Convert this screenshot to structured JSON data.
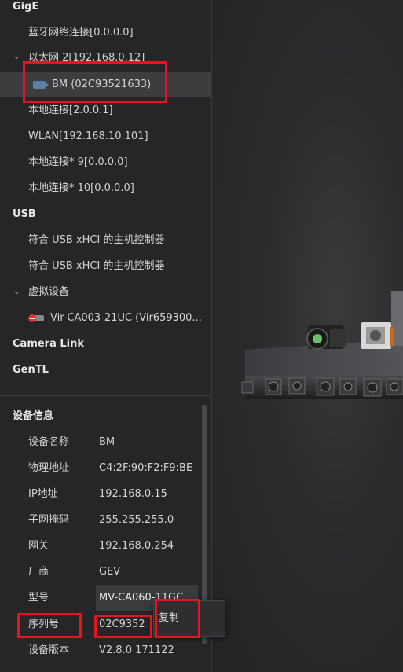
{
  "tree": {
    "gige": {
      "label": "GigE"
    },
    "items": [
      {
        "label": "蓝牙网络连接[0.0.0.0]"
      },
      {
        "label": "以太网 2[192.168.0.12]"
      },
      {
        "label": "BM (02C93521633)"
      },
      {
        "label": "本地连接[2.0.0.1]"
      },
      {
        "label": "WLAN[192.168.10.101]"
      },
      {
        "label": "本地连接* 9[0.0.0.0]"
      },
      {
        "label": "本地连接* 10[0.0.0.0]"
      }
    ],
    "usb": {
      "label": "USB"
    },
    "usb_items": [
      {
        "label": "符合 USB xHCI 的主机控制器"
      },
      {
        "label": "符合 USB xHCI 的主机控制器"
      },
      {
        "label": "虚拟设备"
      },
      {
        "label": "Vir-CA003-21UC (Vir659300..."
      }
    ],
    "camera_link": {
      "label": "Camera Link"
    },
    "gentl": {
      "label": "GenTL"
    }
  },
  "device_info": {
    "title": "设备信息",
    "props": [
      {
        "label": "设备名称",
        "value": "BM"
      },
      {
        "label": "物理地址",
        "value": "C4:2F:90:F2:F9:BE"
      },
      {
        "label": "IP地址",
        "value": "192.168.0.15"
      },
      {
        "label": "子网掩码",
        "value": "255.255.255.0"
      },
      {
        "label": "网关",
        "value": "192.168.0.254"
      },
      {
        "label": "厂商",
        "value": "GEV"
      },
      {
        "label": "型号",
        "value": "MV-CA060-11GC"
      },
      {
        "label": "序列号",
        "value": "02C9352"
      },
      {
        "label": "设备版本",
        "value": "V2.8.0 171122"
      }
    ]
  },
  "context_menu": {
    "copy": "复制"
  },
  "colors": {
    "highlight": "#e6141e",
    "selected_row": "#3d3d40",
    "background": "#262628"
  },
  "icons": [
    "camera-icon",
    "virtual-camera-error-icon",
    "chevron-down-icon"
  ]
}
